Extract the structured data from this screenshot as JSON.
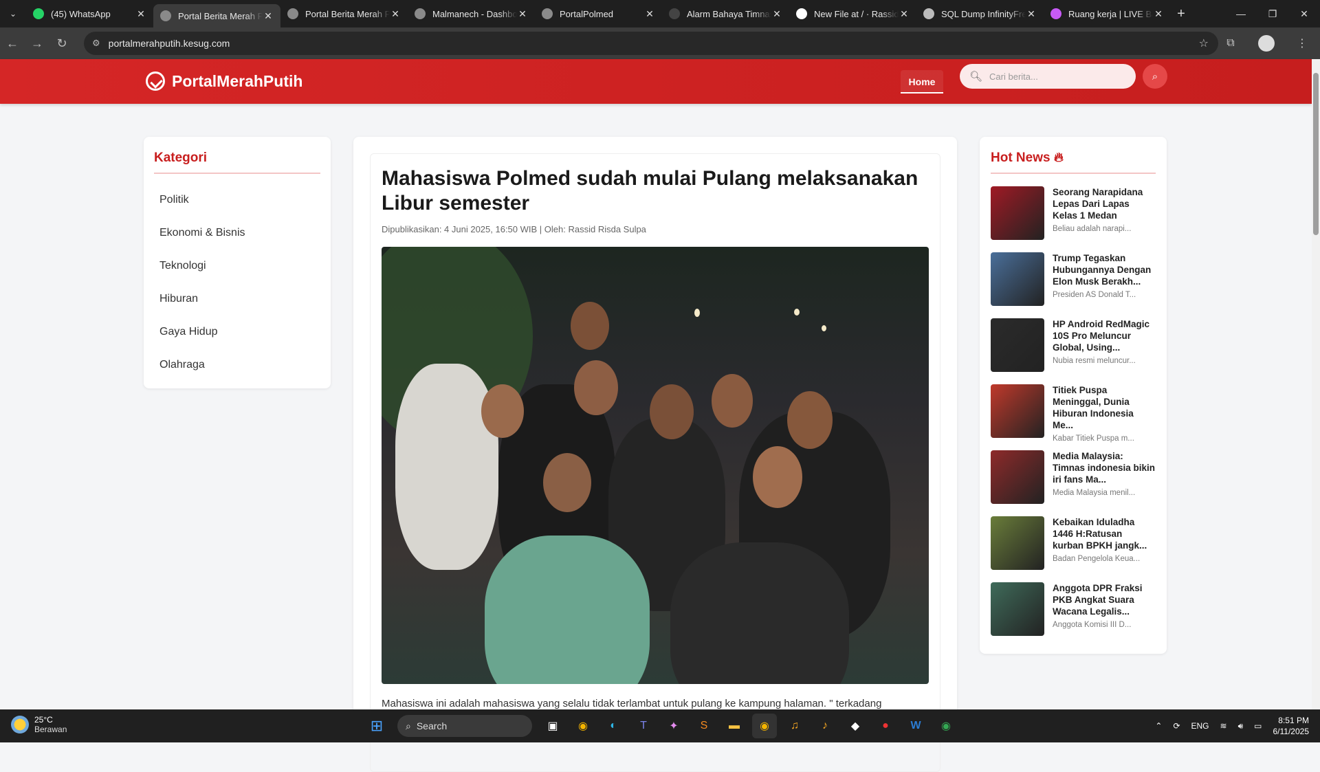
{
  "browser": {
    "tabs": [
      {
        "title": "(45) WhatsApp",
        "color": "#25d366"
      },
      {
        "title": "Portal Berita Merah Putih",
        "color": "#8a8a8a",
        "active": true
      },
      {
        "title": "Portal Berita Merah Putih",
        "color": "#8a8a8a"
      },
      {
        "title": "Malmanech - Dashboard",
        "color": "#8a8a8a"
      },
      {
        "title": "PortalPolmed",
        "color": "#8a8a8a"
      },
      {
        "title": "Alarm Bahaya Timnas",
        "color": "#444"
      },
      {
        "title": "New File at / · Rassid",
        "color": "#ffffff"
      },
      {
        "title": "SQL Dump InfinityFree",
        "color": "#bbbbbb"
      },
      {
        "title": "Ruang kerja | LIVE Ba",
        "color": "#c75af6"
      }
    ],
    "url": "portalmerahputih.kesug.com"
  },
  "site": {
    "name": "PortalMerahPutih",
    "nav_home": "Home",
    "search_placeholder": "Cari berita..."
  },
  "sidebar": {
    "title": "Kategori",
    "items": [
      "Politik",
      "Ekonomi & Bisnis",
      "Teknologi",
      "Hiburan",
      "Gaya Hidup",
      "Olahraga"
    ]
  },
  "article": {
    "title": "Mahasiswa Polmed sudah mulai Pulang melaksanakan Libur semester",
    "meta": "Dipublikasikan: 4 Juni 2025, 16:50 WIB | Oleh: Rassid Risda Sulpa",
    "body": "Mahasiswa ini adalah mahasiswa yang selalu tidak terlambat untuk pulang ke kampung halaman. \" terkadang"
  },
  "hot_news": {
    "title": "Hot News",
    "items": [
      {
        "title": "Seorang Narapidana Lepas Dari Lapas Kelas 1 Medan",
        "snippet": "Beliau adalah narapi...",
        "color": "#a01a24"
      },
      {
        "title": "Trump Tegaskan Hubungannya Dengan Elon Musk Berakh...",
        "snippet": "Presiden AS Donald T...",
        "color": "#4a6f9a"
      },
      {
        "title": "HP Android RedMagic 10S Pro Meluncur Global, Using...",
        "snippet": "Nubia resmi meluncur...",
        "color": "#2b2b2b"
      },
      {
        "title": "Titiek Puspa Meninggal, Dunia Hiburan Indonesia Me...",
        "snippet": "Kabar Titiek Puspa m...",
        "color": "#c0392b"
      },
      {
        "title": "Media Malaysia: Timnas indonesia bikin iri fans Ma...",
        "snippet": "Media Malaysia menil...",
        "color": "#8e2a2a"
      },
      {
        "title": "Kebaikan Iduladha 1446 H:Ratusan kurban BPKH jangk...",
        "snippet": "Badan Pengelola Keua...",
        "color": "#6a7d3a"
      },
      {
        "title": "Anggota DPR Fraksi PKB Angkat Suara Wacana Legalis...",
        "snippet": "Anggota Komisi III D...",
        "color": "#3f6b5a"
      }
    ]
  },
  "taskbar": {
    "temp": "25°C",
    "weather": "Berawan",
    "search": "Search",
    "lang": "ENG",
    "time": "8:51 PM",
    "date": "6/11/2025"
  }
}
